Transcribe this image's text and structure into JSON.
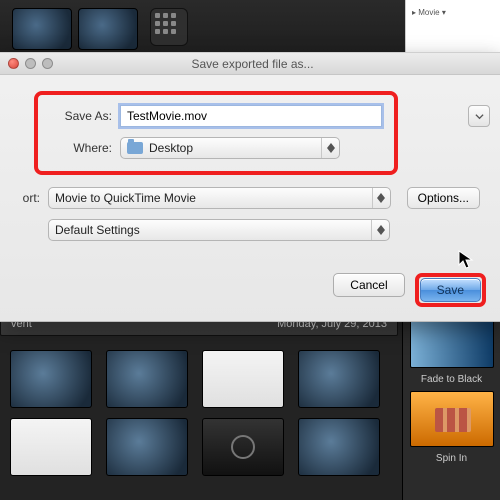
{
  "dialog": {
    "title": "Save exported file as...",
    "save_as_label": "Save As:",
    "filename": "TestMovie.mov",
    "where_label": "Where:",
    "where_value": "Desktop",
    "export_label": "ort:",
    "export_value": "Movie to QuickTime Movie",
    "settings_value": "Default Settings",
    "options_label": "Options...",
    "cancel_label": "Cancel",
    "save_label": "Save"
  },
  "background": {
    "movie_dropdown": "Movie",
    "event_label": "vent",
    "event_date": "Monday, July 29, 2013",
    "transitions": [
      {
        "name": "Fade to Black"
      },
      {
        "name": "Spin In"
      }
    ]
  },
  "colors": {
    "highlight_red": "#ef1f1f",
    "aqua_blue": "#6fa9e8"
  }
}
